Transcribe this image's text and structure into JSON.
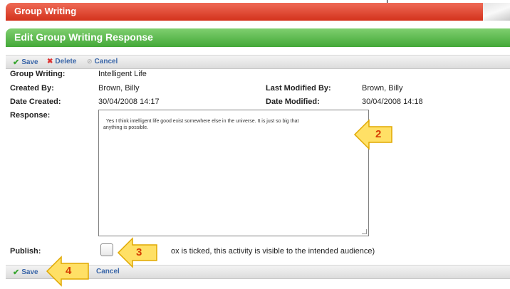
{
  "header": {
    "title": "Group Writing"
  },
  "subheader": {
    "title": "Edit Group Writing Response"
  },
  "toolbar_top": {
    "save": "Save",
    "delete": "Delete",
    "cancel": "Cancel"
  },
  "details": {
    "group_writing_label": "Group Writing:",
    "group_writing_value": "Intelligent Life",
    "created_by_label": "Created By:",
    "created_by_value": "Brown, Billy",
    "last_modified_by_label": "Last Modified By:",
    "last_modified_by_value": "Brown, Billy",
    "date_created_label": "Date Created:",
    "date_created_value": "30/04/2008 14:17",
    "date_modified_label": "Date Modified:",
    "date_modified_value": "30/04/2008 14:18",
    "response_label": "Response:",
    "response_value": "Yes I think intelligent life good exist somewhere else in the universe. It is just so big that\nanything is possible.",
    "publish_label": "Publish:",
    "publish_hint": "ox is ticked, this activity is visible to the intended audience)"
  },
  "toolbar_bottom": {
    "save": "Save",
    "cancel": "Cancel"
  },
  "callouts": {
    "step2": "2",
    "step3": "3",
    "step4": "4"
  },
  "colors": {
    "header_red": "#d3321c",
    "header_green": "#43a838",
    "link_blue": "#3a66a8",
    "callout_yellow": "#ffe066"
  }
}
